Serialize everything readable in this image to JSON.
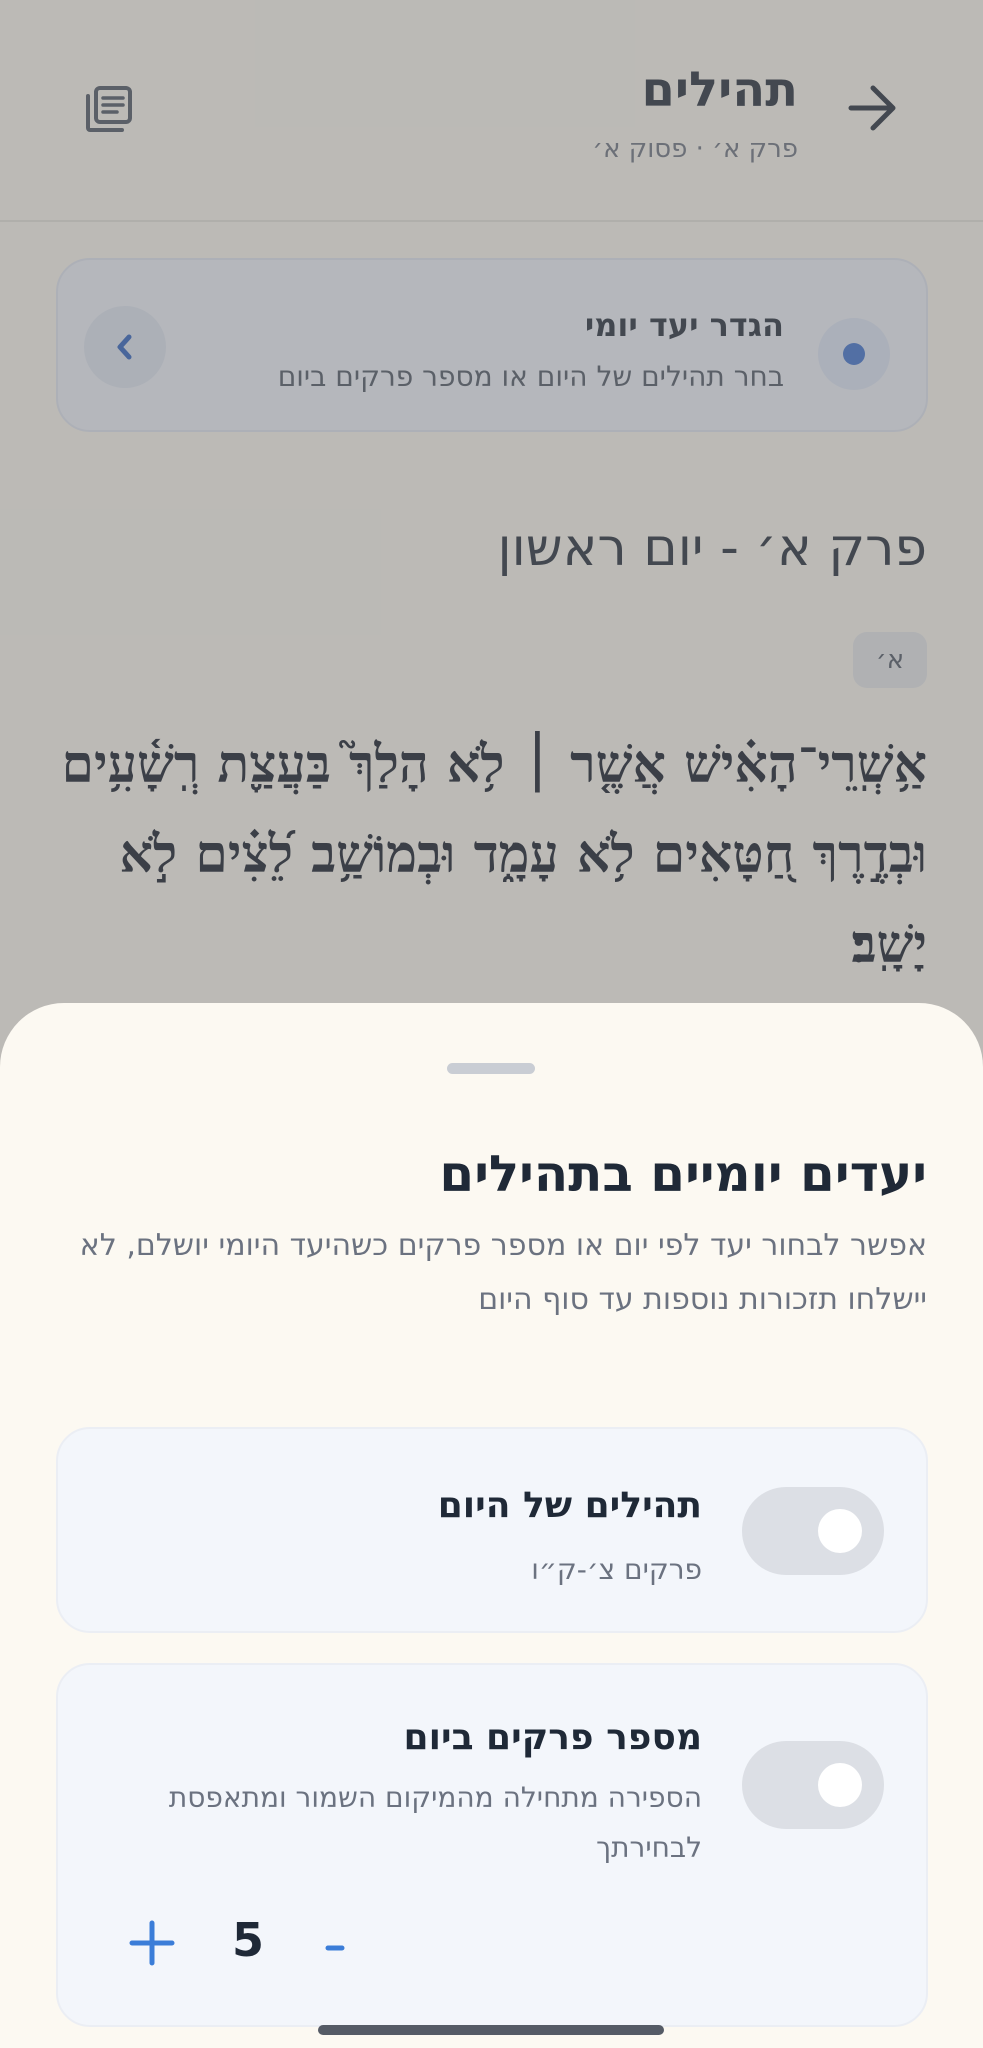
{
  "header": {
    "title": "תהילים",
    "subtitle": "פרק א׳ · פסוק א׳",
    "back_icon": "arrow-right-icon",
    "book_icon": "book-list-icon"
  },
  "goal_card": {
    "title": "הגדר יעד יומי",
    "subtitle": "בחר תהילים של היום או מספר פרקים ביום"
  },
  "reading": {
    "chapter_heading": "פרק א׳ - יום ראשון",
    "verse_badge": "א׳",
    "verse_text": "אַ֥שְֽׁרֵי־הָאִ֗ישׁ אֲשֶׁ֤ר ׀ לֹ֥א הָלַךְ֮ בַּעֲצַ֪ת רְֽשָׁ֫עִ֥ים וּבְדֶ֣רֶךְ חַ֭טָּאִים לֹ֥א עָמָ֑ד וּבְמוֹשַׁ֥ב לֵ֝צִ֗ים לֹ֣א יָשָֽׁב׃"
  },
  "sheet": {
    "title": "יעדים יומיים בתהילים",
    "description": "אפשר לבחור יעד לפי יום או מספר פרקים כשהיעד היומי יושלם, לא יישלחו תזכורות נוספות עד סוף היום",
    "options": [
      {
        "title": "תהילים של היום",
        "subtitle": "פרקים צ׳-ק״ו",
        "enabled": false
      },
      {
        "title": "מספר פרקים ביום",
        "subtitle": "הספירה מתחילה מהמיקום השמור ומתאפסת לבחירתך",
        "enabled": false,
        "stepper": {
          "value": "5",
          "plus": "+",
          "minus": "-"
        }
      }
    ]
  },
  "colors": {
    "accent": "#3b7dd8",
    "sheet_bg": "#fcf9f2",
    "card_bg": "#f3f6fb"
  }
}
